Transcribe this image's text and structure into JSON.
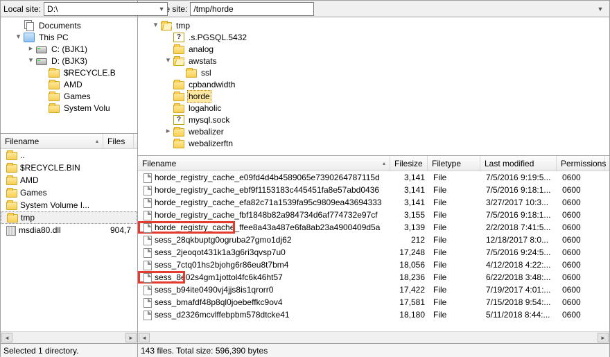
{
  "local": {
    "path_label": "Local site:",
    "path_value": "D:\\",
    "tree": [
      {
        "indent": 1,
        "exp": "",
        "icon": "docs",
        "label": "Documents"
      },
      {
        "indent": 1,
        "exp": "open",
        "icon": "pc",
        "label": "This PC"
      },
      {
        "indent": 2,
        "exp": "closed",
        "icon": "drive",
        "label": "C: (BJK1)"
      },
      {
        "indent": 2,
        "exp": "open",
        "icon": "drive",
        "label": "D: (BJK3)"
      },
      {
        "indent": 3,
        "exp": "",
        "icon": "folder",
        "label": "$RECYCLE.B"
      },
      {
        "indent": 3,
        "exp": "",
        "icon": "folder",
        "label": "AMD"
      },
      {
        "indent": 3,
        "exp": "",
        "icon": "folder",
        "label": "Games"
      },
      {
        "indent": 3,
        "exp": "",
        "icon": "folder",
        "label": "System Volu"
      }
    ],
    "list_headers": {
      "filename": "Filename",
      "filesize": "Files"
    },
    "list_items": [
      {
        "icon": "folder",
        "name": "..",
        "size": ""
      },
      {
        "icon": "folder",
        "name": "$RECYCLE.BIN",
        "size": ""
      },
      {
        "icon": "folder",
        "name": "AMD",
        "size": ""
      },
      {
        "icon": "folder",
        "name": "Games",
        "size": ""
      },
      {
        "icon": "folder",
        "name": "System Volume I...",
        "size": ""
      },
      {
        "icon": "folder",
        "name": "tmp",
        "size": "",
        "sel": true
      },
      {
        "icon": "dll",
        "name": "msdia80.dll",
        "size": "904,7"
      }
    ],
    "status": "Selected 1 directory."
  },
  "remote": {
    "path_label": "Remote site:",
    "path_value": "/tmp/horde",
    "tree": [
      {
        "indent": 1,
        "exp": "open",
        "icon": "folder-open",
        "label": "tmp"
      },
      {
        "indent": 2,
        "exp": "",
        "icon": "q",
        "label": ".s.PGSQL.5432"
      },
      {
        "indent": 2,
        "exp": "",
        "icon": "folder",
        "label": "analog"
      },
      {
        "indent": 2,
        "exp": "open",
        "icon": "folder-open",
        "label": "awstats"
      },
      {
        "indent": 3,
        "exp": "",
        "icon": "folder",
        "label": "ssl"
      },
      {
        "indent": 2,
        "exp": "",
        "icon": "folder",
        "label": "cpbandwidth"
      },
      {
        "indent": 2,
        "exp": "",
        "icon": "folder",
        "label": "horde",
        "sel": true
      },
      {
        "indent": 2,
        "exp": "",
        "icon": "folder",
        "label": "logaholic"
      },
      {
        "indent": 2,
        "exp": "",
        "icon": "q",
        "label": "mysql.sock"
      },
      {
        "indent": 2,
        "exp": "closed",
        "icon": "folder",
        "label": "webalizer"
      },
      {
        "indent": 2,
        "exp": "",
        "icon": "folder",
        "label": "webalizerftn"
      }
    ],
    "list_headers": {
      "filename": "Filename",
      "filesize": "Filesize",
      "filetype": "Filetype",
      "modified": "Last modified",
      "perm": "Permissions"
    },
    "list_items": [
      {
        "name": "horde_registry_cache_e09fd4d4b4589065e7390264787115d",
        "size": "3,141",
        "type": "File",
        "mod": "7/5/2016 9:19:5...",
        "perm": "0600"
      },
      {
        "name": "horde_registry_cache_ebf9f1153183c445451fa8e57abd0436",
        "size": "3,141",
        "type": "File",
        "mod": "7/5/2016 9:18:1...",
        "perm": "0600"
      },
      {
        "name": "horde_registry_cache_efa82c71a1539fa95c9809ea43694333",
        "size": "3,141",
        "type": "File",
        "mod": "3/27/2017 10:3...",
        "perm": "0600"
      },
      {
        "name": "horde_registry_cache_fbf1848b82a984734d6af774732e97cf",
        "size": "3,155",
        "type": "File",
        "mod": "7/5/2016 9:18:1...",
        "perm": "0600"
      },
      {
        "name": "horde_registry_cache_ffee8a43a487e6fa8ab23a4900409d5a",
        "size": "3,139",
        "type": "File",
        "mod": "2/2/2018 7:41:5...",
        "perm": "0600"
      },
      {
        "name": "sess_28qkbuptg0ogruba27gmo1dj62",
        "size": "212",
        "type": "File",
        "mod": "12/18/2017 8:0...",
        "perm": "0600"
      },
      {
        "name": "sess_2jeoqot431k1a3g6ri3qvsp7u0",
        "size": "17,248",
        "type": "File",
        "mod": "7/5/2016 9:24:5...",
        "perm": "0600"
      },
      {
        "name": "sess_7ctq01hs2bjohg6r86eu8t7bm4",
        "size": "18,056",
        "type": "File",
        "mod": "4/12/2018 4:22:...",
        "perm": "0600"
      },
      {
        "name": "sess_8e02s4gm1jottol4fc6k46ht57",
        "size": "18,236",
        "type": "File",
        "mod": "6/22/2018 3:48:...",
        "perm": "0600"
      },
      {
        "name": "sess_b94ite0490vj4jjs8is1qrorr0",
        "size": "17,422",
        "type": "File",
        "mod": "7/19/2017 4:01:...",
        "perm": "0600"
      },
      {
        "name": "sess_bmafdf48p8ql0joebeffkc9ov4",
        "size": "17,581",
        "type": "File",
        "mod": "7/15/2018 9:54:...",
        "perm": "0600"
      },
      {
        "name": "sess_d2326mcvlffebpbm578dtcke41",
        "size": "18,180",
        "type": "File",
        "mod": "5/11/2018 8:44:...",
        "perm": "0600"
      }
    ],
    "status": "143 files. Total size: 596,390 bytes"
  }
}
